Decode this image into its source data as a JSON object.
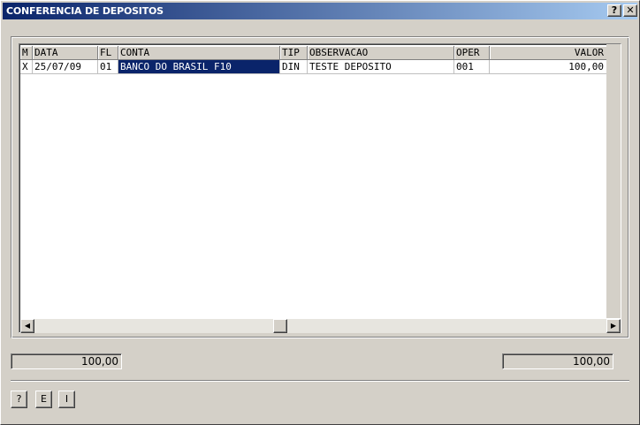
{
  "window": {
    "title": "CONFERENCIA DE DEPOSITOS",
    "help_label": "?",
    "close_label": "✕"
  },
  "grid": {
    "columns": [
      "M",
      "DATA",
      "FL",
      "CONTA",
      "TIP",
      "OBSERVACAO",
      "OPER",
      "VALOR"
    ],
    "rows": [
      {
        "m": "X",
        "data": "25/07/09",
        "fl": "01",
        "conta": "BANCO DO BRASIL F10",
        "tip": "DIN",
        "observacao": "TESTE DEPOSITO",
        "oper": "001",
        "valor": "100,00"
      }
    ],
    "selection_color": "#0a246a"
  },
  "totals": {
    "left": "100,00",
    "right": "100,00"
  },
  "buttons": {
    "help": "?",
    "e": "E",
    "i": "I"
  },
  "icons": {
    "scroll_left": "◀",
    "scroll_right": "▶"
  }
}
